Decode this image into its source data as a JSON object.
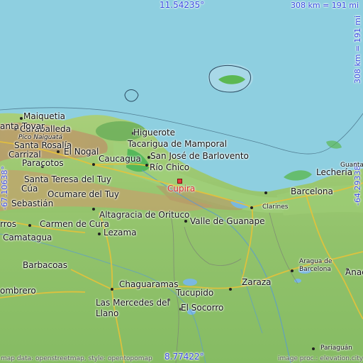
{
  "map": {
    "coords": {
      "north": "11.54235°",
      "south": "8.77422°",
      "west": "-67.10638°",
      "east": "-64.29338°",
      "scale_top": "308 km = 191 mi",
      "scale_right": "308 km = 191 mi"
    },
    "highlight_place": "Cupira",
    "places": {
      "maiquetia": "Maiquetia",
      "caraballeda": "Caraballeda",
      "pico_naiguata": "Pico Naiguatá",
      "san_tovar": "anta Tovar",
      "santa_rosalia": "Santa Rosalía",
      "carrizal": "Carrizal",
      "el_nogal": "El Nogal",
      "paracotos": "Paracotos",
      "santa_teresa": "Santa Teresa del Tuy",
      "cua": "Cúa",
      "ocumare": "Ocumare del Tuy",
      "sebastian": "Sebastián",
      "higuerote": "Higuerote",
      "tacarigua": "Tacarigua de Mamporal",
      "caucagua": "Caucagua",
      "san_jose": "San José de Barlovento",
      "rio_chico": "Río Chico",
      "guanta": "Guanta",
      "lecheria": "Lechería",
      "barcelona": "Barcelona",
      "clarines": "Clarines",
      "altagracia": "Altagracia de Orituco",
      "valle": "Valle de Guanape",
      "carmen": "Carmen de Cura",
      "lezama": "Lezama",
      "rros": "rros",
      "camatagua": "Camatagua",
      "barbacoas": "Barbacoas",
      "ombrero": "ombrero",
      "chaguaramas": "Chaguaramas",
      "tucupido": "Tucupido",
      "zaraza": "Zaraza",
      "aragua_line1": "Aragua de",
      "aragua_line2": "Barcelona",
      "anac": "Anac",
      "las_mercedes1": "Las Mercedes del",
      "las_mercedes2": "Llano",
      "el_socorro": "El Socorro",
      "pariaguan": "Pariaguán"
    },
    "attribution_left": "map data: openstreetmap, style: opentopomap",
    "attribution_right": "image proc.: elevation.city"
  }
}
